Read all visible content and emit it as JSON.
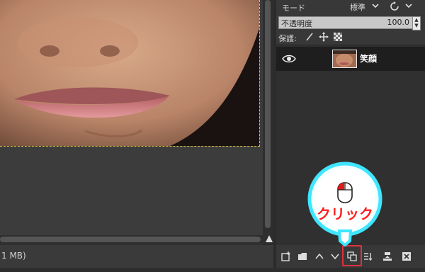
{
  "status": {
    "text": "1 MB)"
  },
  "layers_panel": {
    "mode_label": "モード",
    "mode_value": "標準",
    "opacity_label": "不透明度",
    "opacity_value": "100.0",
    "opacity_fraction": 1.0,
    "lock_label": "保護:",
    "layers": [
      {
        "name": "笑顔",
        "visible": true
      }
    ]
  },
  "callout": {
    "text": "クリック"
  },
  "colors": {
    "highlight": "#e03040",
    "callout_ring": "#3fe6ff",
    "callout_text": "#ff1f1f"
  }
}
